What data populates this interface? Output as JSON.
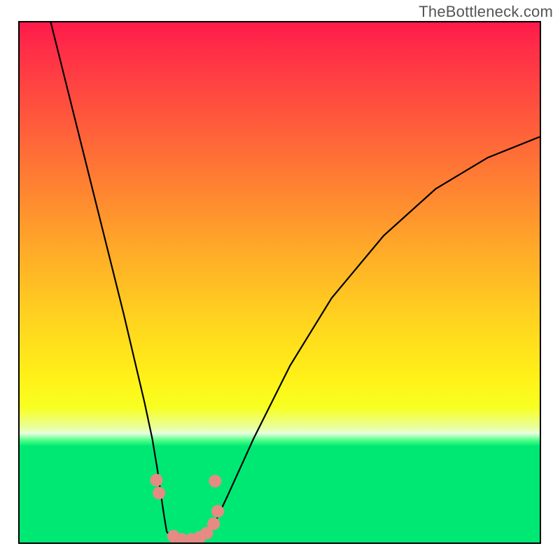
{
  "watermark": "TheBottleneck.com",
  "chart_data": {
    "type": "line",
    "title": "",
    "xlabel": "",
    "ylabel": "",
    "xlim": [
      0,
      1
    ],
    "ylim": [
      0,
      1
    ],
    "background_gradient": {
      "orientation": "vertical",
      "stops": [
        {
          "pos": 0.0,
          "color": "#ff1a4b"
        },
        {
          "pos": 0.45,
          "color": "#ffab28"
        },
        {
          "pos": 0.74,
          "color": "#f8ff20"
        },
        {
          "pos": 0.81,
          "color": "#00e874"
        },
        {
          "pos": 1.0,
          "color": "#00e874"
        }
      ]
    },
    "series": [
      {
        "name": "left_arm",
        "x": [
          0.06,
          0.09,
          0.12,
          0.15,
          0.175,
          0.2,
          0.22,
          0.24,
          0.255,
          0.265,
          0.272,
          0.278,
          0.283
        ],
        "y": [
          1.0,
          0.88,
          0.76,
          0.64,
          0.54,
          0.44,
          0.355,
          0.27,
          0.2,
          0.14,
          0.09,
          0.05,
          0.02
        ]
      },
      {
        "name": "valley_floor",
        "x": [
          0.283,
          0.3,
          0.32,
          0.34,
          0.355,
          0.368
        ],
        "y": [
          0.02,
          0.008,
          0.004,
          0.006,
          0.012,
          0.022
        ]
      },
      {
        "name": "right_arm",
        "x": [
          0.368,
          0.4,
          0.45,
          0.52,
          0.6,
          0.7,
          0.8,
          0.9,
          1.0
        ],
        "y": [
          0.022,
          0.09,
          0.2,
          0.34,
          0.47,
          0.59,
          0.68,
          0.74,
          0.78
        ]
      }
    ],
    "markers": [
      {
        "x": 0.263,
        "y": 0.12
      },
      {
        "x": 0.268,
        "y": 0.095
      },
      {
        "x": 0.296,
        "y": 0.012
      },
      {
        "x": 0.312,
        "y": 0.006
      },
      {
        "x": 0.33,
        "y": 0.006
      },
      {
        "x": 0.346,
        "y": 0.01
      },
      {
        "x": 0.36,
        "y": 0.018
      },
      {
        "x": 0.373,
        "y": 0.036
      },
      {
        "x": 0.376,
        "y": 0.118
      },
      {
        "x": 0.381,
        "y": 0.06
      }
    ],
    "marker_color": "#e58b84",
    "frame_color": "#000000"
  }
}
